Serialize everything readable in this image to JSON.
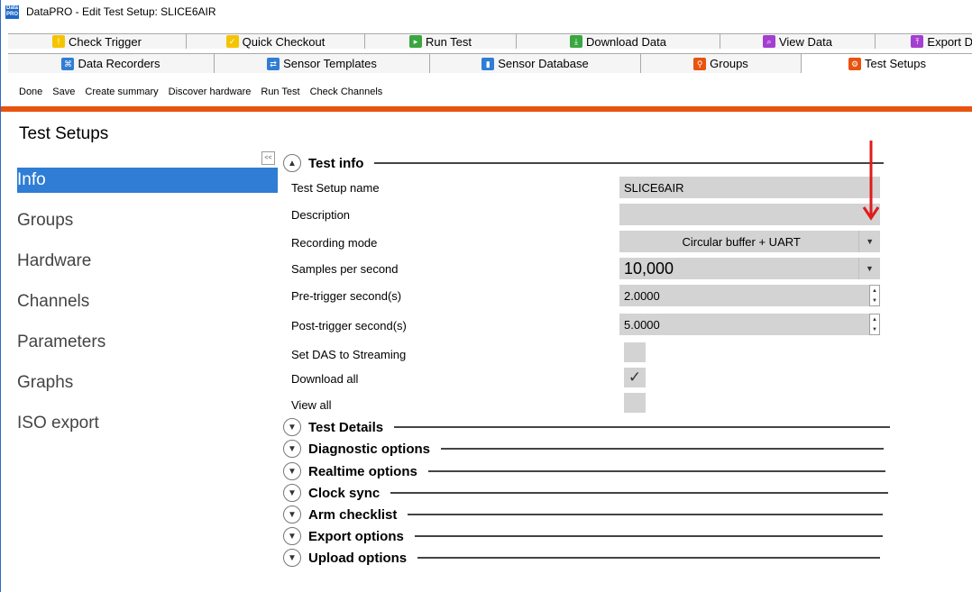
{
  "window": {
    "title": "DataPRO  - Edit Test Setup: SLICE6AIR",
    "app_icon_text": "Data PRO"
  },
  "tabs_row1": [
    {
      "label": "Check Trigger",
      "icon": "check-trigger-icon",
      "color": "#f5c400"
    },
    {
      "label": "Quick Checkout",
      "icon": "quick-checkout-icon",
      "color": "#f5c400"
    },
    {
      "label": "Run Test",
      "icon": "run-test-icon",
      "color": "#3aa640"
    },
    {
      "label": "Download Data",
      "icon": "download-icon",
      "color": "#3aa640"
    },
    {
      "label": "View Data",
      "icon": "view-data-icon",
      "color": "#a43fd1"
    },
    {
      "label": "Export D",
      "icon": "export-icon",
      "color": "#a43fd1"
    }
  ],
  "tabs_row2": [
    {
      "label": "Data Recorders",
      "icon": "data-recorders-icon",
      "color": "#2f7dd4"
    },
    {
      "label": "Sensor Templates",
      "icon": "sensor-templates-icon",
      "color": "#2f7dd4"
    },
    {
      "label": "Sensor Database",
      "icon": "sensor-database-icon",
      "color": "#2f7dd4"
    },
    {
      "label": "Groups",
      "icon": "groups-icon",
      "color": "#e8530f"
    },
    {
      "label": "Test Setups",
      "icon": "test-setups-icon",
      "color": "#e8530f"
    }
  ],
  "toolbar": {
    "done": "Done",
    "save": "Save",
    "create_summary": "Create summary",
    "discover_hardware": "Discover hardware",
    "run_test": "Run Test",
    "check_channels": "Check Channels"
  },
  "page_title": "Test Setups",
  "collapse_label": "<<",
  "nav": [
    "Info",
    "Groups",
    "Hardware",
    "Channels",
    "Parameters",
    "Graphs",
    "ISO export"
  ],
  "test_info": {
    "title": "Test info",
    "fields": {
      "setup_name_label": "Test Setup name",
      "setup_name_value": "SLICE6AIR",
      "description_label": "Description",
      "description_value": "",
      "recording_mode_label": "Recording mode",
      "recording_mode_value": "Circular buffer + UART",
      "sps_label": "Samples per second",
      "sps_value": "10,000",
      "pre_trigger_label": "Pre-trigger second(s)",
      "pre_trigger_value": "2.0000",
      "post_trigger_label": "Post-trigger second(s)",
      "post_trigger_value": "5.0000",
      "das_streaming_label": "Set DAS to Streaming",
      "das_streaming_checked": false,
      "download_all_label": "Download all",
      "download_all_checked": true,
      "download_all_mark": "✓",
      "view_all_label": "View all",
      "view_all_checked": false
    }
  },
  "sections": [
    "Test Details",
    "Diagnostic options",
    "Realtime options",
    "Clock sync",
    "Arm checklist",
    "Export options",
    "Upload options"
  ],
  "colors": {
    "accent": "#e8530f",
    "selection": "#2f7dd4",
    "annotation_arrow": "#e01b1b"
  }
}
